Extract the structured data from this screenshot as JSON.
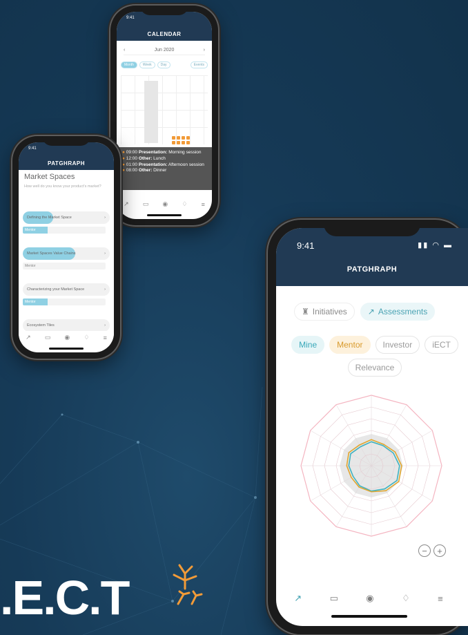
{
  "calendar_phone": {
    "time": "9:41",
    "title": "CALENDAR",
    "month": "Jun 2020",
    "prev": "‹",
    "next": "›",
    "pills": [
      "Month",
      "Week",
      "Day",
      "Events"
    ],
    "events": [
      {
        "time": "09:00",
        "type": "Presentation:",
        "label": "Morning session"
      },
      {
        "time": "12:00",
        "type": "Other:",
        "label": "Lunch"
      },
      {
        "time": "01:00",
        "type": "Presentation:",
        "label": "Afternoon session"
      },
      {
        "time": "08:00",
        "type": "Other:",
        "label": "Dinner"
      }
    ]
  },
  "market_phone": {
    "time": "9:41",
    "title": "PATGHRAPH",
    "heading": "Market Spaces",
    "subtitle": "How well do you know your product's market?",
    "items": [
      {
        "label": "Defining the Market Space",
        "progress": 0.35,
        "tag": "Mentor"
      },
      {
        "label": "Market Spaces Value Chains",
        "progress": 0.6,
        "tag": "Mentor"
      },
      {
        "label": "Characterizing your Market Space",
        "progress": 0.0,
        "tag": "Mentor"
      },
      {
        "label": "Ecosystem Tiles",
        "progress": 0.0,
        "tag": ""
      }
    ],
    "chevron": "›"
  },
  "main_phone": {
    "time": "9:41",
    "status_icons": "▮▮ ◠ ▬",
    "title": "PATGHRAPH",
    "segments": [
      {
        "label": "Initiatives",
        "icon": "rocket-icon",
        "active": false
      },
      {
        "label": "Assessments",
        "icon": "trend-icon",
        "active": true
      }
    ],
    "filters": [
      "Mine",
      "Mentor",
      "Investor",
      "iECT",
      "Relevance"
    ],
    "zoom_out": "−",
    "zoom_in": "+"
  },
  "chart_data": {
    "type": "radar",
    "axes_count": 12,
    "rings": 6,
    "series": [
      {
        "name": "Mine",
        "color": "#3fb3c1",
        "values": [
          0.34,
          0.33,
          0.36,
          0.4,
          0.42,
          0.38,
          0.36,
          0.33,
          0.3,
          0.32,
          0.34,
          0.31
        ]
      },
      {
        "name": "Mentor",
        "color": "#e0a731",
        "values": [
          0.37,
          0.35,
          0.39,
          0.43,
          0.45,
          0.41,
          0.37,
          0.35,
          0.33,
          0.35,
          0.37,
          0.34
        ]
      }
    ],
    "colors": {
      "outer_ring": "#f4b4c0",
      "inner_fill": "#e7e7e7"
    }
  },
  "logo": {
    "text": ".E.C.T"
  },
  "colors": {
    "brand": "#213a54",
    "accent": "#f29b38",
    "teal": "#3fb3c1"
  }
}
